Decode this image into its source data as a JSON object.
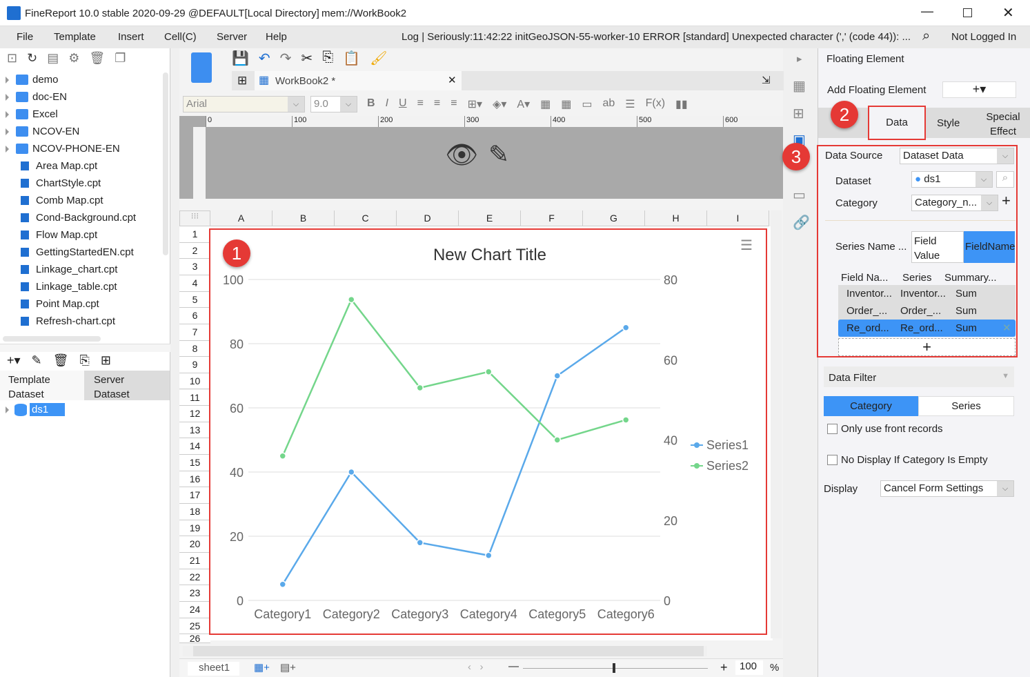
{
  "window": {
    "title": "FineReport 10.0 stable 2020-09-29 @DEFAULT[Local Directory]",
    "doc": "mem://WorkBook2"
  },
  "menu": {
    "items": [
      "File",
      "Template",
      "Insert",
      "Cell(C)",
      "Server",
      "Help"
    ],
    "log": "Log | Seriously:11:42:22 initGeoJSON-55-worker-10 ERROR [standard] Unexpected character (',' (code 44)): ...",
    "login": "Not Logged In"
  },
  "tree": {
    "folders": [
      "demo",
      "doc-EN",
      "Excel",
      "NCOV-EN",
      "NCOV-PHONE-EN"
    ],
    "files": [
      "Area Map.cpt",
      "ChartStyle.cpt",
      "Comb Map.cpt",
      "Cond-Background.cpt",
      "Flow Map.cpt",
      "GettingStartedEN.cpt",
      "Linkage_chart.cpt",
      "Linkage_table.cpt",
      "Point Map.cpt",
      "Refresh-chart.cpt"
    ]
  },
  "dataset_panel": {
    "tab_template": "Template Dataset",
    "tab_server": "Server Dataset",
    "item": "ds1"
  },
  "editor": {
    "tab": "WorkBook2 *",
    "font": "Arial",
    "size": "9.0",
    "ruler": [
      "0",
      "100",
      "200",
      "300",
      "400",
      "500",
      "600"
    ],
    "columns": [
      "A",
      "B",
      "C",
      "D",
      "E",
      "F",
      "G",
      "H",
      "I"
    ],
    "sheet": "sheet1",
    "zoom": "100",
    "zoom_unit": "%"
  },
  "annotations": [
    "1",
    "2",
    "3"
  ],
  "chart_data": {
    "type": "line",
    "title": "New Chart Title",
    "categories": [
      "Category1",
      "Category2",
      "Category3",
      "Category4",
      "Category5",
      "Category6"
    ],
    "y_left": {
      "ticks": [
        "0",
        "20",
        "40",
        "60",
        "80",
        "100"
      ],
      "range": [
        0,
        100
      ]
    },
    "y_right": {
      "ticks": [
        "0",
        "20",
        "40",
        "60",
        "80"
      ],
      "range": [
        0,
        80
      ]
    },
    "series": [
      {
        "name": "Series1",
        "axis": "left",
        "color": "#5aa9ea",
        "values": [
          5,
          40,
          18,
          14,
          70,
          85
        ]
      },
      {
        "name": "Series2",
        "axis": "right",
        "color": "#74d68b",
        "values": [
          36,
          75,
          53,
          57,
          40,
          45
        ]
      }
    ],
    "legend": "right",
    "grid": true
  },
  "panel": {
    "title": "Floating Element",
    "add_label": "Add Floating Element",
    "tabs": [
      "Data",
      "Style",
      "Special Effect"
    ],
    "data_source_label": "Data Source",
    "data_source": "Dataset Data",
    "dataset_label": "Dataset",
    "dataset": "ds1",
    "category_label": "Category",
    "category": "Category_n...",
    "series_name_label": "Series Name ...",
    "series_opt1": "Field Value",
    "series_opt2": "FieldName",
    "table_headers": [
      "Field Na...",
      "Series",
      "Summary..."
    ],
    "rows": [
      [
        "Inventor...",
        "Inventor...",
        "Sum"
      ],
      [
        "Order_...",
        "Order_...",
        "Sum"
      ],
      [
        "Re_ord...",
        "Re_ord...",
        "Sum"
      ]
    ],
    "filter_label": "Data Filter",
    "filter_tabs": [
      "Category",
      "Series"
    ],
    "opt_front": "Only use front records",
    "opt_empty": "No Display If Category Is Empty",
    "display_label": "Display",
    "display": "Cancel Form Settings"
  },
  "colors": {
    "accent": "#3d94f6",
    "highlight": "#e53935"
  }
}
